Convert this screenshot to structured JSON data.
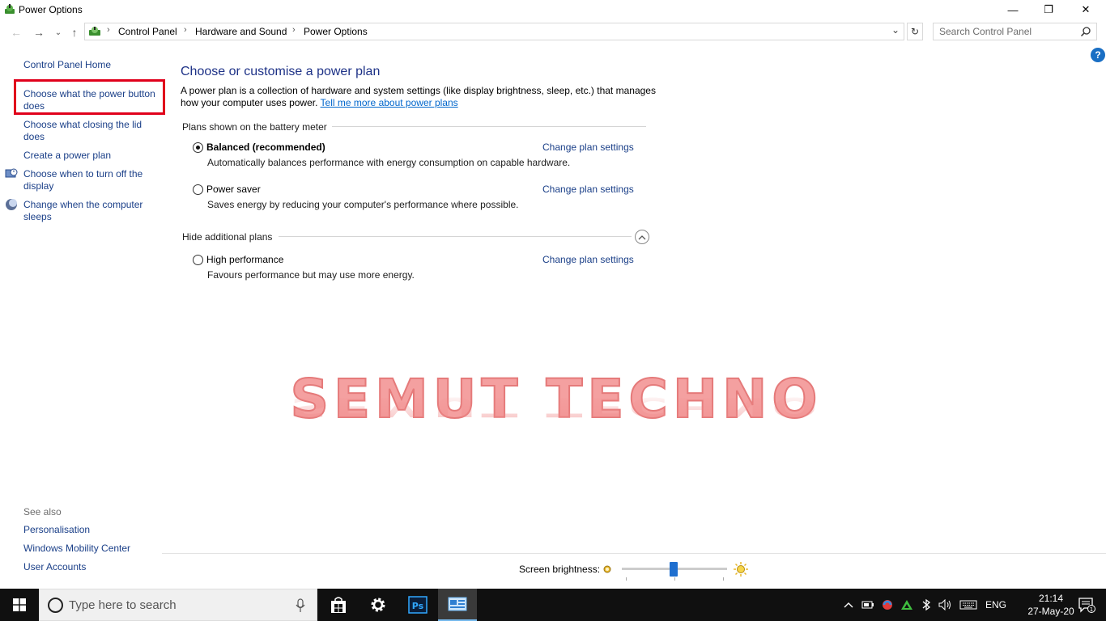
{
  "window": {
    "title": "Power Options",
    "minimize": "—",
    "maximize": "❐",
    "close": "✕"
  },
  "nav": {
    "back": "←",
    "forward": "→",
    "recent": "⌄",
    "up": "↑",
    "dropdown": "⌄",
    "refresh": "↻"
  },
  "breadcrumb": {
    "items": [
      "Control Panel",
      "Hardware and Sound",
      "Power Options"
    ],
    "separator": "›"
  },
  "search": {
    "placeholder": "Search Control Panel"
  },
  "help": {
    "label": "?"
  },
  "sidebar": {
    "home": "Control Panel Home",
    "links": [
      "Choose what the power button does",
      "Choose what closing the lid does",
      "Create a power plan",
      "Choose when to turn off the display",
      "Change when the computer sleeps"
    ],
    "see_also_title": "See also",
    "see_also": [
      "Personalisation",
      "Windows Mobility Center",
      "User Accounts"
    ]
  },
  "main": {
    "title": "Choose or customise a power plan",
    "description": "A power plan is a collection of hardware and system settings (like display brightness, sleep, etc.) that manages how your computer uses power. ",
    "learn_more": "Tell me more about power plans",
    "battery_group": "Plans shown on the battery meter",
    "hidden_group": "Hide additional plans",
    "change_link": "Change plan settings",
    "plans": [
      {
        "name": "Balanced (recommended)",
        "desc": "Automatically balances performance with energy consumption on capable hardware.",
        "selected": true
      },
      {
        "name": "Power saver",
        "desc": "Saves energy by reducing your computer's performance where possible.",
        "selected": false
      },
      {
        "name": "High performance",
        "desc": "Favours performance but may use more energy.",
        "selected": false
      }
    ]
  },
  "watermark": {
    "text": "SEMUT TECHNO",
    "color": "#f08a8a"
  },
  "brightness": {
    "label": "Screen brightness:",
    "value_fraction": 0.49
  },
  "taskbar": {
    "search_placeholder": "Type here to search",
    "language": "ENG",
    "time": "21:14",
    "date": "27-May-20",
    "notifications": "1"
  },
  "colors": {
    "link": "#1a3f88",
    "title": "#1e3287",
    "highlight": "#e0001b",
    "accent": "#1f6fcf"
  }
}
